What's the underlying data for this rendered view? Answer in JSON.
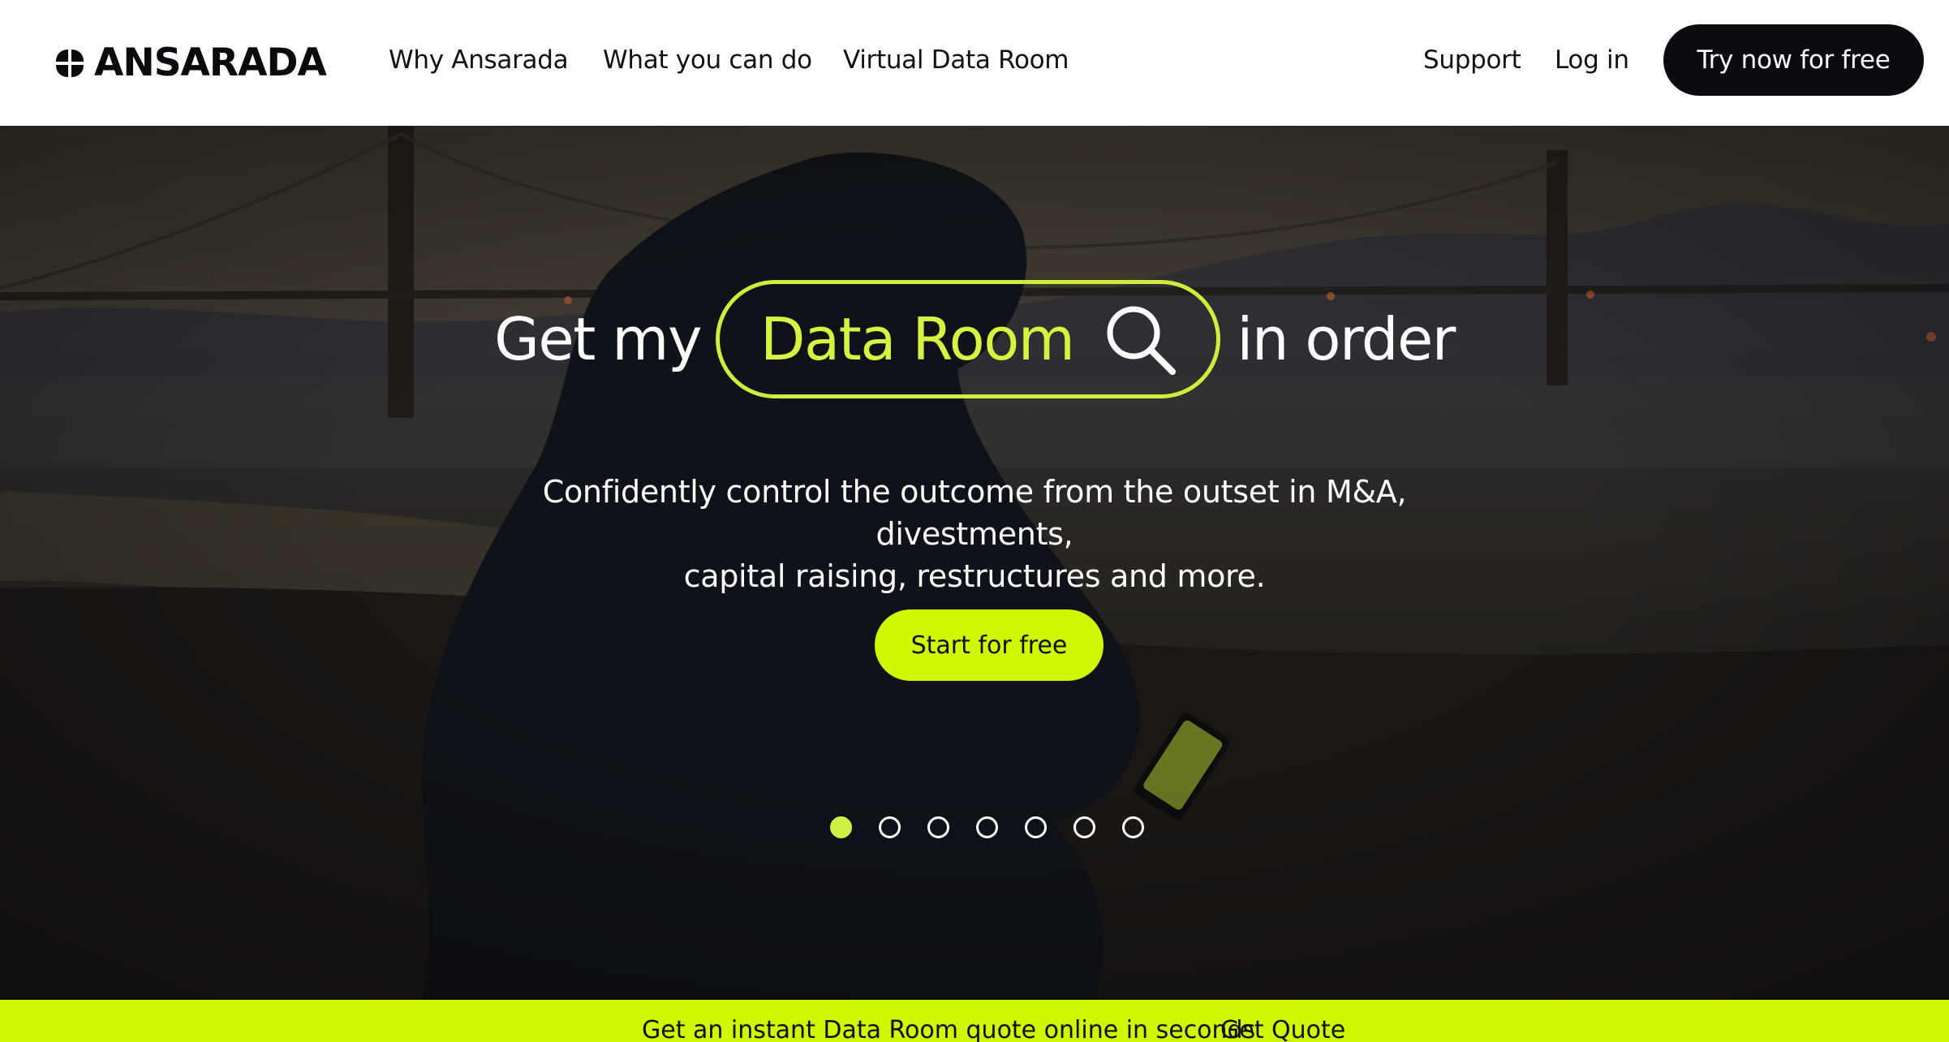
{
  "brand": {
    "name": "ANSARADA"
  },
  "nav": {
    "links": [
      "Why Ansarada",
      "What you can do",
      "Virtual Data Room"
    ],
    "support": "Support",
    "login": "Log in",
    "cta": "Try now for free"
  },
  "hero": {
    "title_prefix": "Get my",
    "search_term": "Data Room",
    "title_suffix": "in order",
    "subtitle_line1": "Confidently control the outcome from the outset in M&A, divestments,",
    "subtitle_line2": "capital raising, restructures and more.",
    "cta": "Start for free",
    "carousel": {
      "total": 7,
      "active_index": 0
    }
  },
  "banner": {
    "text": "Get an instant Data Room quote online in seconds",
    "link": "Get Quote"
  },
  "colors": {
    "accent": "#cdf802",
    "dark": "#0b0b12",
    "pill_outline": "#cdef3b"
  }
}
